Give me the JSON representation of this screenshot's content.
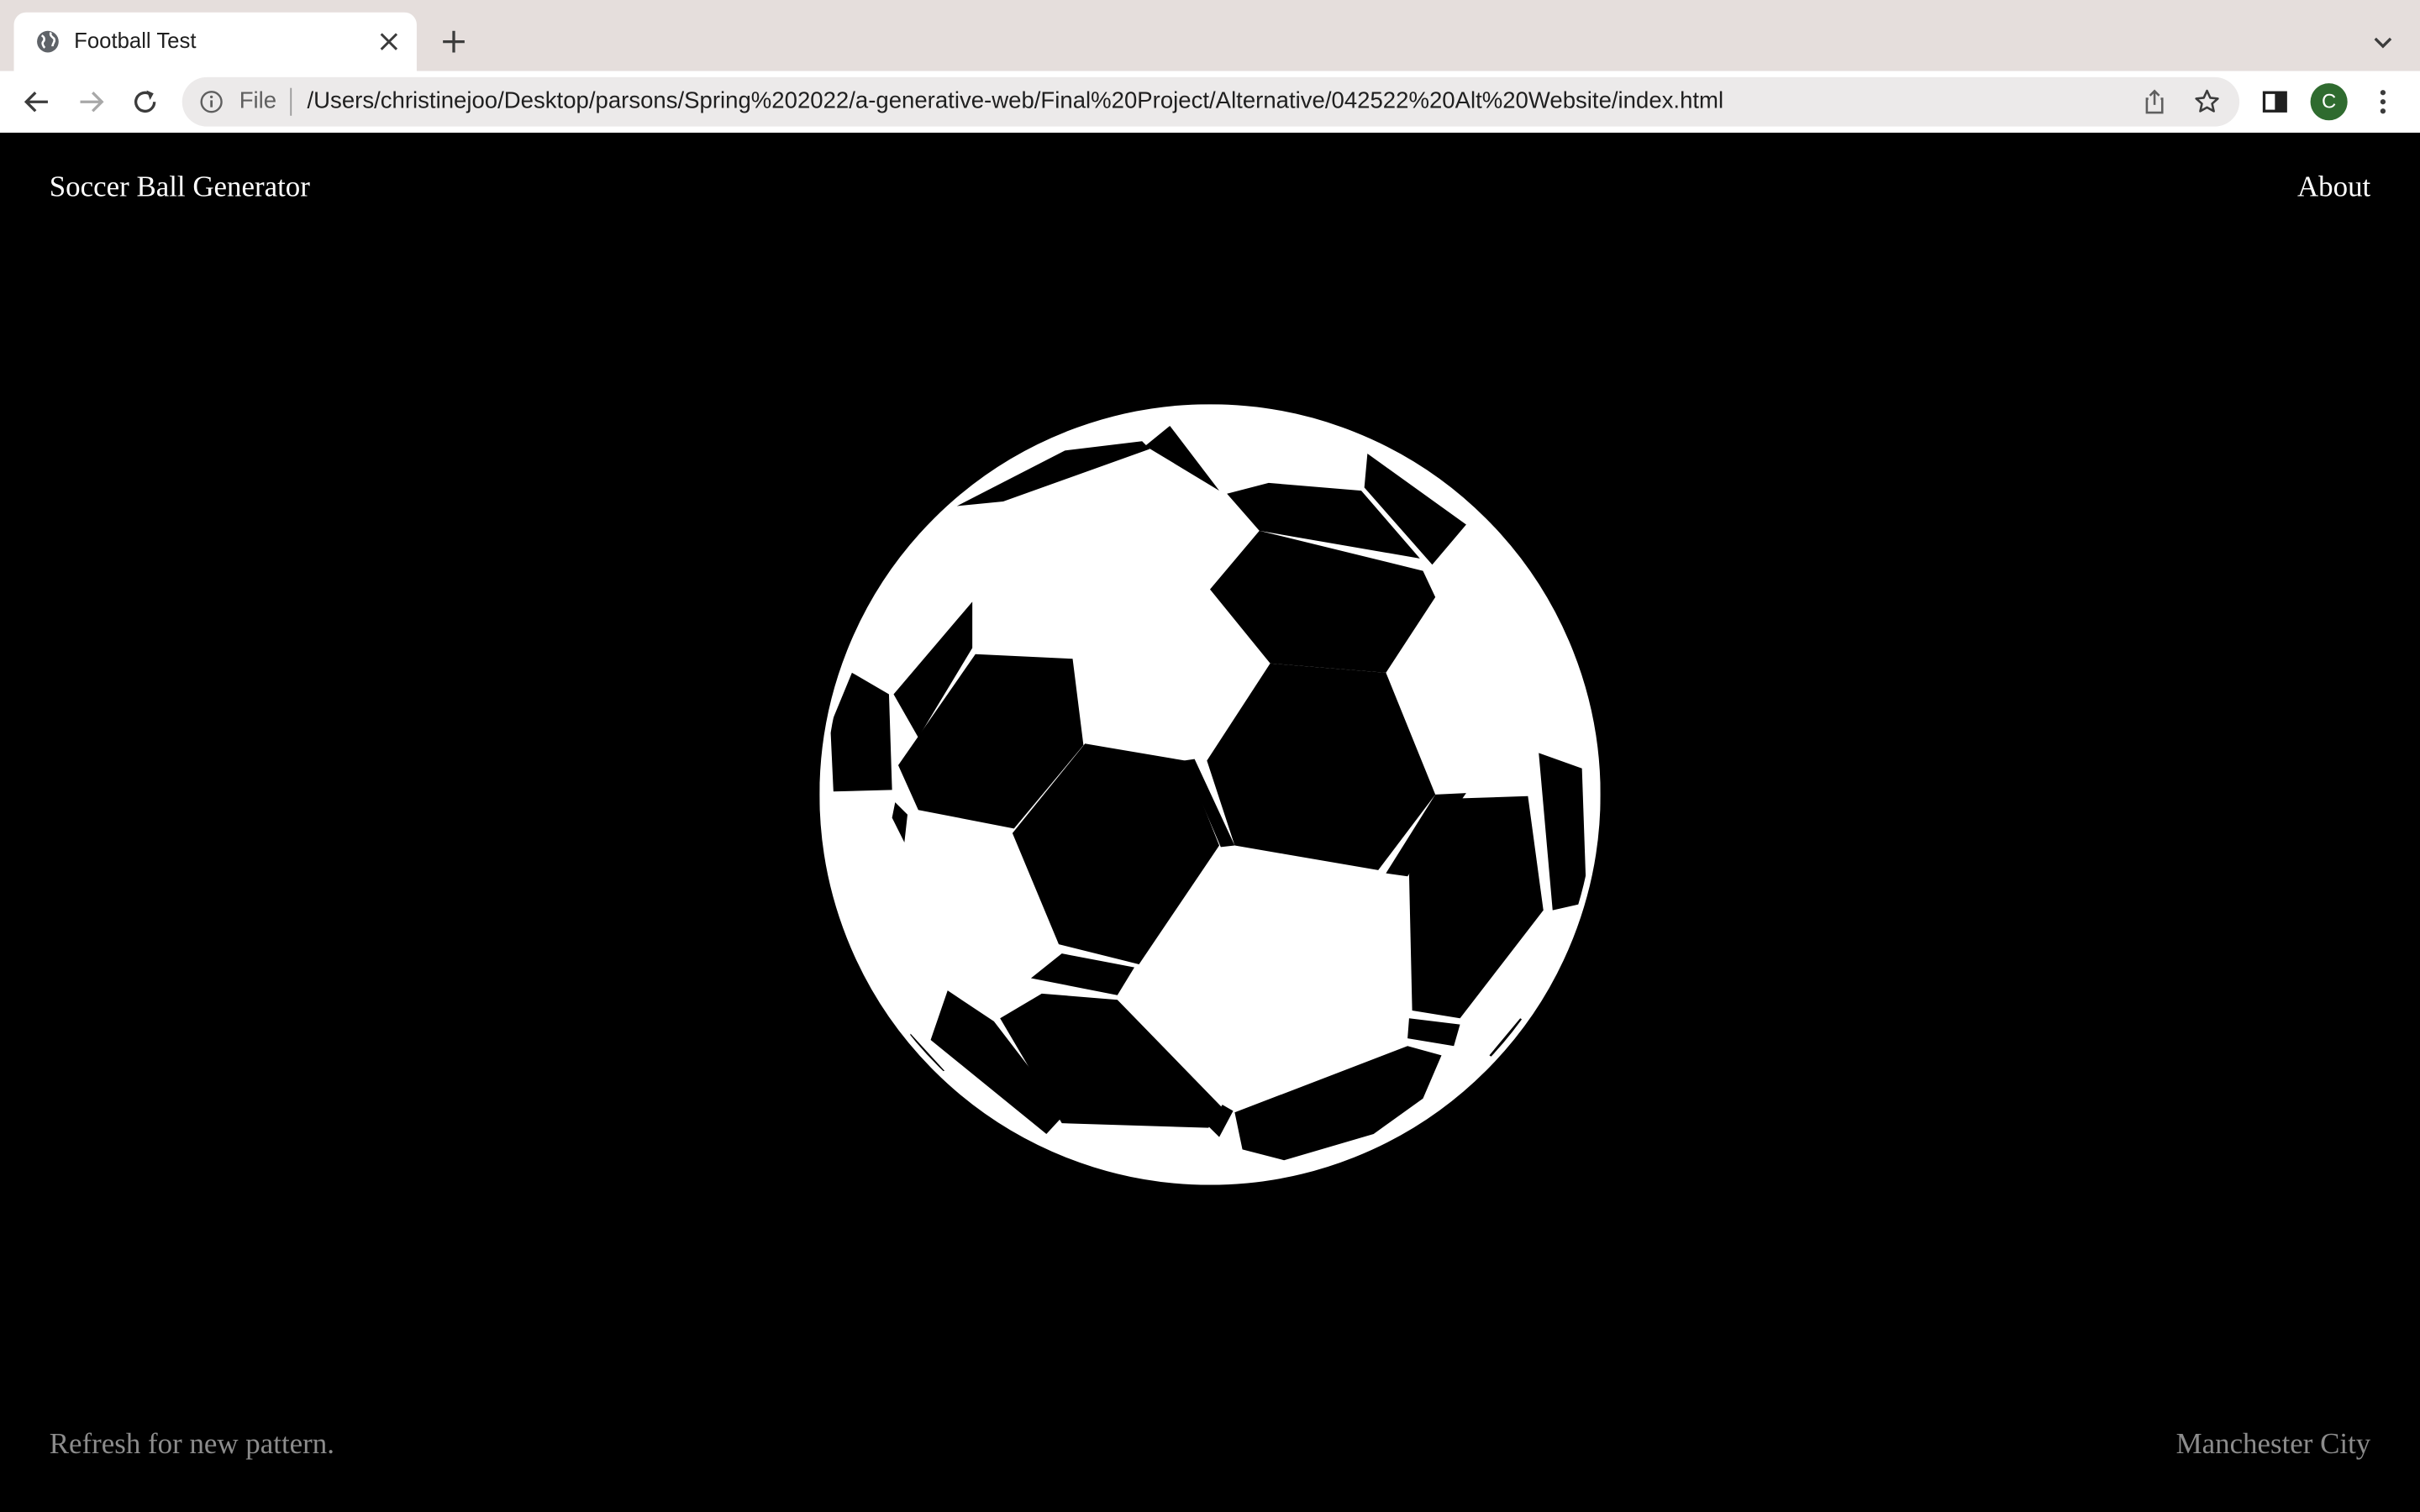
{
  "browser": {
    "tab": {
      "title": "Football Test",
      "favicon": "globe-icon"
    },
    "address_bar": {
      "scheme_label": "File",
      "url": "/Users/christinejoo/Desktop/parsons/Spring%202022/a-generative-web/Final%20Project/Alternative/042522%20Alt%20Website/index.html"
    },
    "profile_initial": "C",
    "colors": {
      "tabstrip_bg": "#e5dedc",
      "omnibox_bg": "#eceaea",
      "avatar_bg": "#2f6b2f"
    }
  },
  "page": {
    "site_title": "Soccer Ball Generator",
    "nav_about": "About",
    "hint": "Refresh for new pattern.",
    "team_name": "Manchester City",
    "colors": {
      "background": "#000000",
      "ball": "#ffffff",
      "muted_text": "#8c8c8c"
    }
  }
}
